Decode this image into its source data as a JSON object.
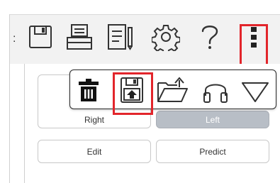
{
  "toolbar": {
    "icons": [
      "floppy-disk-icon",
      "printer-icon",
      "document-edit-icon",
      "gear-icon",
      "help-icon",
      "more-vertical-icon"
    ],
    "separator": ":"
  },
  "popup_menu": {
    "icons": [
      "trash-icon",
      "save-to-device-icon",
      "folder-open-icon",
      "headphones-icon",
      "triangle-down-icon"
    ]
  },
  "buttons": {
    "right_label": "Right",
    "left_label": "Left",
    "edit_label": "Edit",
    "predict_label": "Predict"
  },
  "colors": {
    "highlight": "#e2252b",
    "selected_button": "#b8bec6",
    "toolbar_bg": "#f2f2f2",
    "icon_stroke": "#333333"
  }
}
